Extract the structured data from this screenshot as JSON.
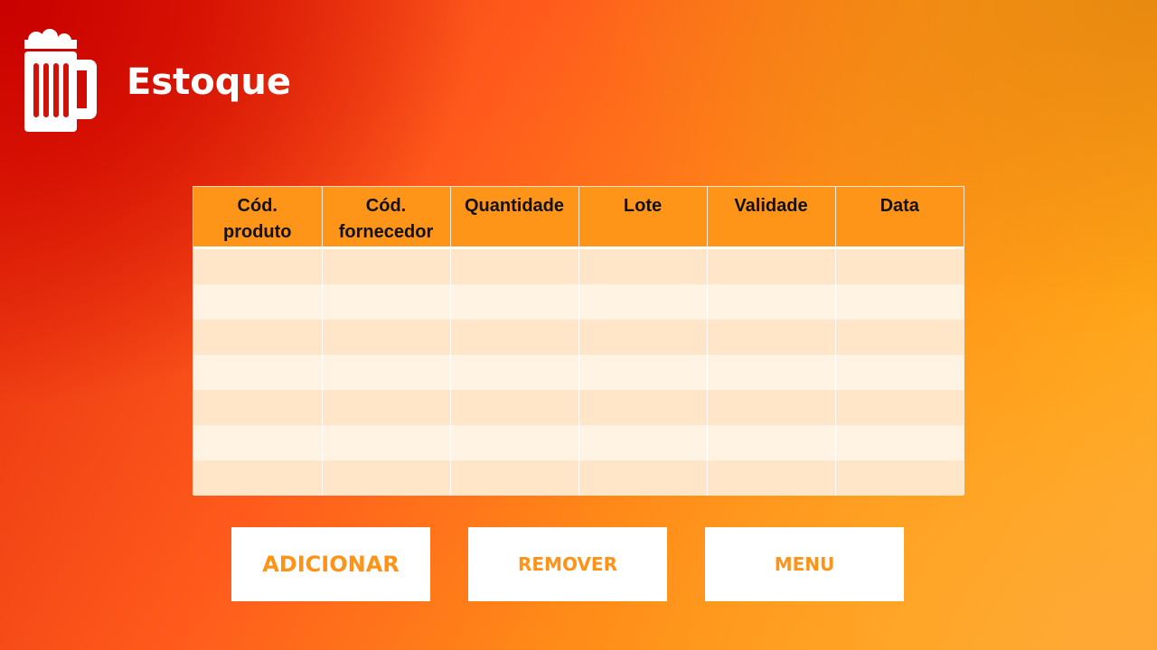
{
  "header": {
    "title": "Estoque",
    "logo_icon": "beer-mug-icon"
  },
  "table": {
    "columns": [
      "Cód.\nproduto",
      "Cód.\nfornecedor",
      "Quantidade",
      "Lote",
      "Validade",
      "Data"
    ],
    "row_count": 7
  },
  "buttons": {
    "add_label": "ADICIONAR",
    "remove_label": "REMOVER",
    "menu_label": "MENU"
  },
  "colors": {
    "accent": "#ff9318",
    "header_cell": "#ff9518",
    "row_odd": "#ffe6c8",
    "row_even": "#fff3e4"
  }
}
